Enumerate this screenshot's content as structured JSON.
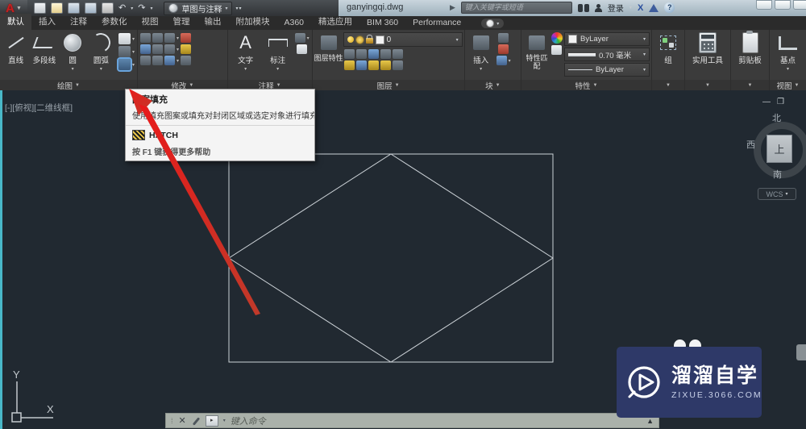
{
  "titlebar": {
    "filename": "ganyingqi.dwg",
    "workspace": "草图与注释",
    "search_placeholder": "键入关键字或短语",
    "signin_label": "登录",
    "exchange_glyph": "X",
    "help_glyph": "?",
    "minimize_glyph": "—",
    "restore_glyph": "❐"
  },
  "tabs": [
    "默认",
    "插入",
    "注释",
    "参数化",
    "视图",
    "管理",
    "输出",
    "附加模块",
    "A360",
    "精选应用",
    "BIM 360",
    "Performance"
  ],
  "ribbon": {
    "draw": {
      "label": "绘图",
      "line": "直线",
      "polyline": "多段线",
      "circle": "圆",
      "arc": "圆弧"
    },
    "modify": {
      "label": "修改"
    },
    "annotate": {
      "label": "注释",
      "text": "文字",
      "dimension": "标注"
    },
    "layers": {
      "label": "图层",
      "properties_btn": "图层特性",
      "current_layer": "0"
    },
    "block": {
      "label": "块",
      "insert": "插入"
    },
    "properties": {
      "label": "特性",
      "match": "特性匹配",
      "color": "ByLayer",
      "lineweight": "0.70 毫米",
      "linetype": "ByLayer"
    },
    "group": {
      "label": "组"
    },
    "utilities": {
      "label": "实用工具"
    },
    "clipboard": {
      "label": "剪贴板"
    },
    "view": {
      "label": "视图",
      "basepoint": "基点"
    }
  },
  "tooltip": {
    "title": "图案填充",
    "description": "使用填充图案或填充对封闭区域或选定对象进行填充",
    "command": "HATCH",
    "help": "按 F1 键获得更多帮助"
  },
  "canvas": {
    "viewport_label": "[-][俯视][二维线框]",
    "viewcube": {
      "north": "北",
      "west": "西",
      "south": "南",
      "top": "上",
      "wcs": "WCS"
    },
    "ucs": {
      "x_label": "X",
      "y_label": "Y"
    }
  },
  "command_line": {
    "placeholder": "键入命令",
    "close_glyph": "✕",
    "popup_glyph": "▲"
  },
  "watermark": {
    "title": "溜溜自学",
    "url": "zixue.3066.com"
  },
  "colors": {
    "canvas_bg": "#212931",
    "ribbon_bg": "#3b3b3b",
    "shape_stroke": "#ccd2d7",
    "arrow_red": "#e01f1f",
    "hatch_highlight": "#6aa4dc",
    "watermark_bg": "#2e3968"
  }
}
